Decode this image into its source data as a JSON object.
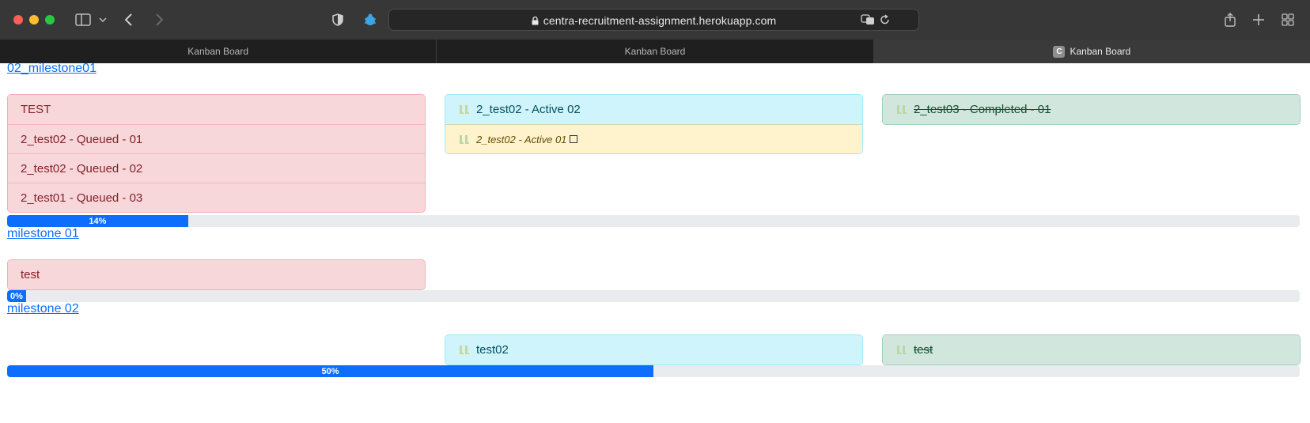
{
  "browser": {
    "url": "centra-recruitment-assignment.herokuapp.com",
    "tabs": [
      {
        "label": "Kanban Board",
        "favicon": ""
      },
      {
        "label": "Kanban Board",
        "favicon": ""
      },
      {
        "label": "Kanban Board",
        "favicon": "C"
      }
    ]
  },
  "milestones": [
    {
      "title": "02_milestone01",
      "progress": 14,
      "progress_label": "14%",
      "queued": [
        "TEST",
        "2_test02 - Queued - 01",
        "2_test02 - Queued - 02",
        "2_test01 - Queued - 03"
      ],
      "active": [
        {
          "label": "2_test02 - Active 02"
        },
        {
          "label": "2_test02 - Active 01",
          "sub": true
        }
      ],
      "completed": [
        "2_test03 - Completed - 01"
      ]
    },
    {
      "title": "milestone 01",
      "progress": 0,
      "progress_label": "0%",
      "queued": [
        "test"
      ],
      "active": [],
      "completed": []
    },
    {
      "title": "milestone 02",
      "progress": 50,
      "progress_label": "50%",
      "queued": [],
      "active": [
        {
          "label": "test02"
        }
      ],
      "completed": [
        "test"
      ]
    }
  ],
  "colors": {
    "queued_bg": "#f8d7da",
    "active_bg": "#cff4fc",
    "active_sub_bg": "#fff3cd",
    "completed_bg": "#d1e7dd",
    "progress": "#0d6efd",
    "link": "#0d6efd"
  }
}
